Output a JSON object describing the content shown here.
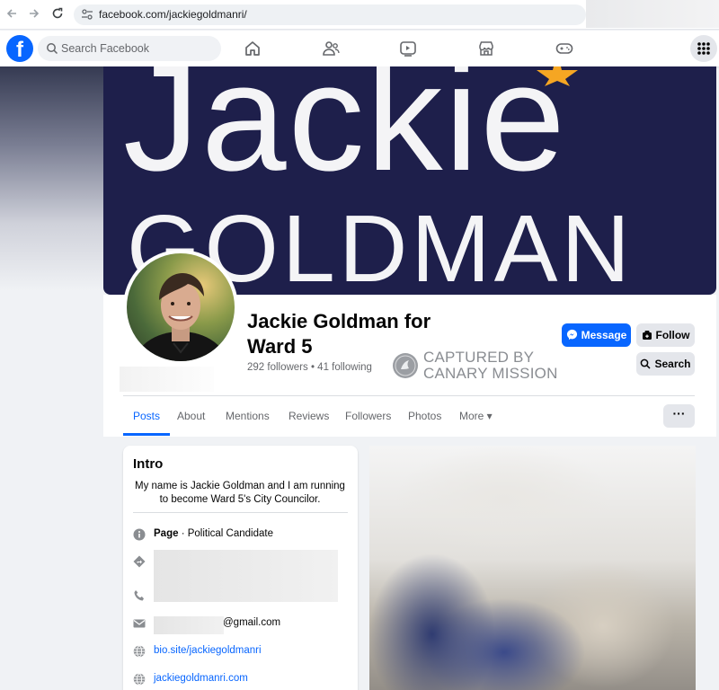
{
  "browser": {
    "url": "facebook.com/jackiegoldmanri/"
  },
  "header": {
    "logo_letter": "f",
    "search_placeholder": "Search Facebook"
  },
  "cover": {
    "line1": "Jackie",
    "line2": "GOLDMAN",
    "star_color": "#f5a623"
  },
  "profile": {
    "name": "Jackie Goldman for Ward 5",
    "followers": "292 followers • 41 following"
  },
  "watermark": {
    "line1": "CAPTURED BY",
    "line2": "CANARY MISSION"
  },
  "actions": {
    "message_label": "Message",
    "follow_label": "Follow",
    "search_label": "Search",
    "more_label": "···"
  },
  "tabs": [
    {
      "label": "Posts"
    },
    {
      "label": "About"
    },
    {
      "label": "Mentions"
    },
    {
      "label": "Reviews"
    },
    {
      "label": "Followers"
    },
    {
      "label": "Photos"
    },
    {
      "label": "More ▾"
    }
  ],
  "intro": {
    "title": "Intro",
    "bio": "My name is Jackie Goldman and I am running to become Ward 5's City Councilor.",
    "page_label": "Page",
    "page_category": " · Political Candidate",
    "email_suffix": "@gmail.com",
    "link1": "bio.site/jackiegoldmanri",
    "link2": "jackiegoldmanri.com"
  },
  "colors": {
    "brand": "#0866ff",
    "cover_bg": "#1e1f4b"
  }
}
